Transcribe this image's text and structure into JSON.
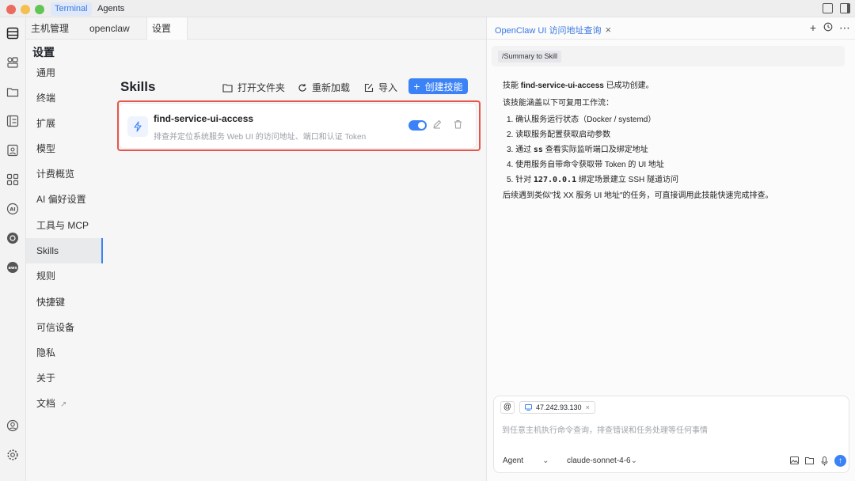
{
  "titlebar": {
    "tabs": [
      "Terminal",
      "Agents"
    ],
    "active_tab": "Terminal"
  },
  "tabs": [
    {
      "label": "主机管理"
    },
    {
      "label": "openclaw"
    },
    {
      "label": "设置"
    }
  ],
  "settings": {
    "title": "设置",
    "sidebar": [
      "通用",
      "终端",
      "扩展",
      "模型",
      "计费概览",
      "AI 偏好设置",
      "工具与 MCP",
      "Skills",
      "规则",
      "快捷键",
      "可信设备",
      "隐私",
      "关于",
      "文档"
    ],
    "active": "Skills"
  },
  "skills": {
    "title": "Skills",
    "open_folder": "打开文件夹",
    "reload": "重新加载",
    "import": "导入",
    "create": "创建技能",
    "items": [
      {
        "name": "find-service-ui-access",
        "description": "排查并定位系统服务 Web UI 的访问地址、端口和认证 Token",
        "enabled": true
      }
    ]
  },
  "right_panel": {
    "tab_title": "OpenClaw UI 访问地址查询",
    "summary_chip": "/Summary to Skill",
    "messages": {
      "created_prefix": "技能 ",
      "created_name": "find-service-ui-access",
      "created_suffix": " 已成功创建。",
      "intro": "该技能涵盖以下可复用工作流：",
      "steps": [
        {
          "num": "1.",
          "text": "确认服务运行状态（Docker / systemd）"
        },
        {
          "num": "2.",
          "text": "读取服务配置获取启动参数"
        },
        {
          "num": "3.",
          "pre": "通过 ",
          "code": "ss",
          "post": " 查看实际监听端口及绑定地址"
        },
        {
          "num": "4.",
          "text": "使用服务自带命令获取带 Token 的 UI 地址"
        },
        {
          "num": "5.",
          "pre": "针对 ",
          "code": "127.0.0.1",
          "post": " 绑定场景建立 SSH 隧道访问"
        }
      ],
      "footer": "后续遇到类似\"找 XX 服务 UI 地址\"的任务，可直接调用此技能快速完成排查。"
    },
    "input": {
      "at": "@",
      "host": "47.242.93.130",
      "placeholder": "到任意主机执行命令查询，排查错误和任务处理等任何事情",
      "mode": "Agent",
      "model": "claude-sonnet-4-6"
    }
  },
  "colors": {
    "accent": "#3b82f6",
    "highlight": "#e8544a"
  }
}
